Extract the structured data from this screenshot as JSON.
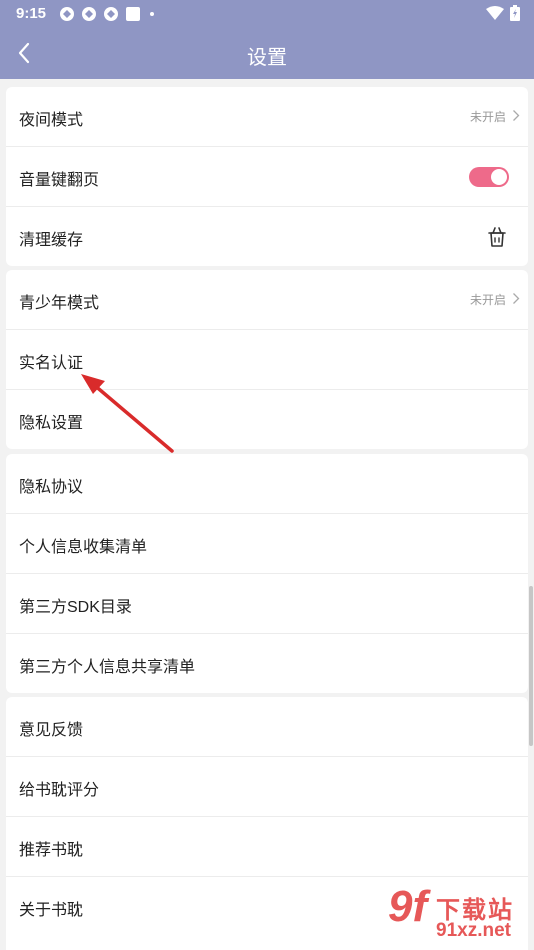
{
  "status_bar": {
    "time": "9:15",
    "icons": [
      "sync-icon",
      "sync-icon",
      "sync-icon",
      "square-icon",
      "dot-icon",
      "wifi-icon",
      "battery-icon"
    ]
  },
  "header": {
    "title": "设置",
    "back_icon": "chevron-left-icon"
  },
  "groups": [
    {
      "items": [
        {
          "label": "夜间模式",
          "value": "未开启",
          "control": "chevron"
        },
        {
          "label": "音量键翻页",
          "control": "toggle",
          "toggle_on": true
        },
        {
          "label": "清理缓存",
          "control": "trash-icon"
        }
      ]
    },
    {
      "items": [
        {
          "label": "青少年模式",
          "value": "未开启",
          "control": "chevron"
        },
        {
          "label": "实名认证"
        },
        {
          "label": "隐私设置"
        }
      ]
    },
    {
      "items": [
        {
          "label": "隐私协议"
        },
        {
          "label": "个人信息收集清单"
        },
        {
          "label": "第三方SDK目录"
        },
        {
          "label": "第三方个人信息共享清单"
        }
      ]
    },
    {
      "items": [
        {
          "label": "意见反馈"
        },
        {
          "label": "给书耽评分"
        },
        {
          "label": "推荐书耽"
        },
        {
          "label": "关于书耽"
        }
      ]
    }
  ],
  "colors": {
    "header_bg": "#8f96c4",
    "toggle_on": "#ee6a8a",
    "annotation_arrow": "#d92b2b"
  },
  "watermark": {
    "number": "9f",
    "top_text": "下载站",
    "bottom_text": "91xz.net"
  }
}
